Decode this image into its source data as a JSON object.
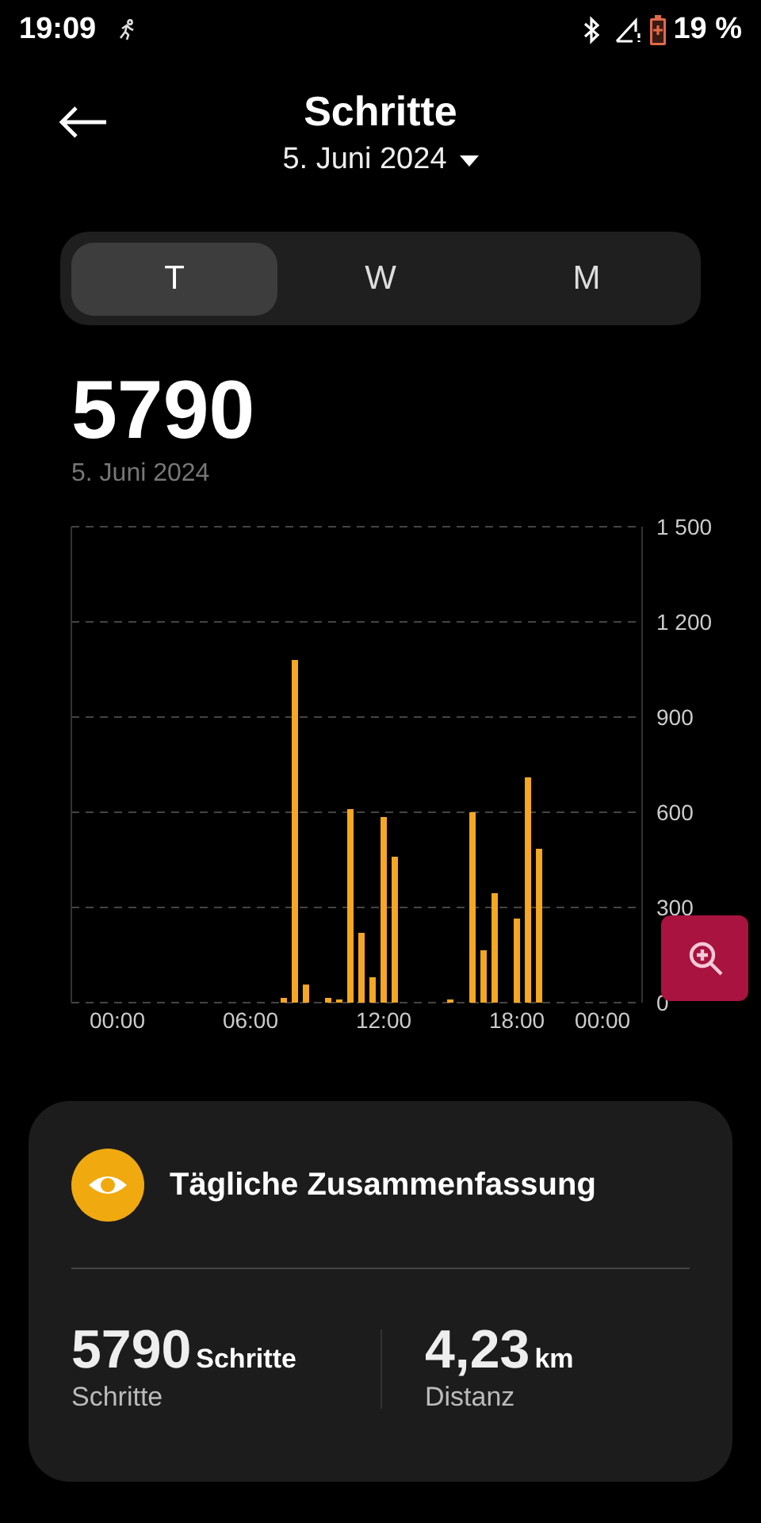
{
  "status_bar": {
    "time": "19:09",
    "battery": "19 %"
  },
  "header": {
    "title": "Schritte",
    "date": "5. Juni 2024"
  },
  "tabs": [
    {
      "label": "T",
      "selected": true
    },
    {
      "label": "W",
      "selected": false
    },
    {
      "label": "M",
      "selected": false
    }
  ],
  "total": {
    "value": "5790",
    "date": "5. Juni 2024"
  },
  "chart_data": {
    "type": "bar",
    "x": [
      7.5,
      8,
      8.5,
      9.5,
      10,
      10.5,
      11,
      11.5,
      12,
      12.5,
      15,
      16,
      16.5,
      17,
      18,
      18.5,
      19
    ],
    "values": [
      15,
      1080,
      57,
      15,
      10,
      610,
      220,
      80,
      585,
      460,
      10,
      600,
      165,
      345,
      265,
      710,
      485
    ],
    "xlim": [
      -2.07,
      23.64
    ],
    "ylim": [
      0,
      1500
    ],
    "grid": true,
    "xticks": [
      {
        "value": 0,
        "label": "00:00"
      },
      {
        "value": 6,
        "label": "06:00"
      },
      {
        "value": 12,
        "label": "12:00"
      },
      {
        "value": 18,
        "label": "18:00"
      },
      {
        "value": 21.86,
        "label": "00:00"
      }
    ],
    "yticks": [
      {
        "value": 0,
        "label": "0"
      },
      {
        "value": 300,
        "label": "300"
      },
      {
        "value": 600,
        "label": "600"
      },
      {
        "value": 900,
        "label": "900"
      },
      {
        "value": 1200,
        "label": "1 200"
      },
      {
        "value": 1500,
        "label": "1 500"
      }
    ]
  },
  "summary": {
    "title": "Tägliche Zusammenfassung",
    "stats": [
      {
        "value": "5790",
        "unit": "Schritte",
        "label": "Schritte"
      },
      {
        "value": "4,23",
        "unit": "km",
        "label": "Distanz"
      }
    ]
  }
}
